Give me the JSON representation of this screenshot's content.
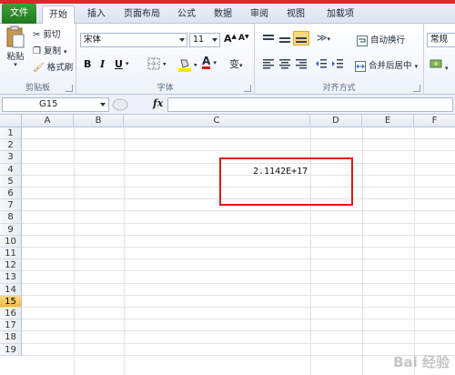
{
  "tabs": [
    "文件",
    "开始",
    "插入",
    "页面布局",
    "公式",
    "数据",
    "审阅",
    "视图",
    "加载项"
  ],
  "clipboard": {
    "paste": "粘贴",
    "cut": "剪切",
    "copy": "复制",
    "format_painter": "格式刷",
    "title": "剪贴板"
  },
  "font": {
    "name": "宋体",
    "size": "11",
    "bold": "B",
    "italic": "I",
    "underline": "U",
    "grow": "A",
    "shrink": "A",
    "title": "字体",
    "phonetic": "变"
  },
  "alignment": {
    "wrap": "自动换行",
    "merge": "合并后居中",
    "title": "对齐方式"
  },
  "number": {
    "format": "常规"
  },
  "formula_bar": {
    "name_box": "G15",
    "fx": "fx",
    "content": ""
  },
  "columns": [
    "A",
    "B",
    "C",
    "D",
    "E",
    "F"
  ],
  "rows": [
    "1",
    "2",
    "3",
    "4",
    "5",
    "6",
    "7",
    "8",
    "9",
    "10",
    "11",
    "12",
    "13",
    "14",
    "15",
    "16",
    "17",
    "18",
    "19"
  ],
  "selected_row": "15",
  "cells": {
    "c4": "2.1142E+17"
  },
  "watermark": "Bai 经验",
  "colors": {
    "file_tab": "#2a8a2a",
    "highlight": "#e01818",
    "selected_row_header": "#f5b73e"
  }
}
